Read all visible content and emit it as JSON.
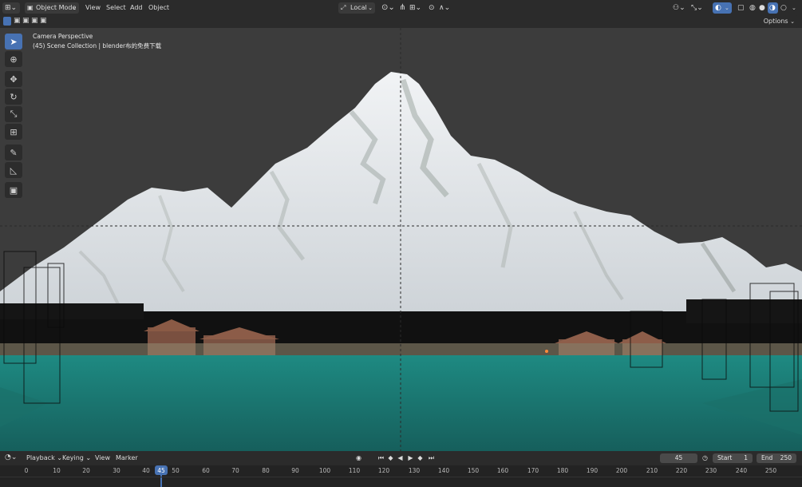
{
  "header": {
    "mode_label": "Object Mode",
    "menus": [
      "View",
      "Select",
      "Add",
      "Object"
    ],
    "orientation_label": "Local",
    "options_label": "Options"
  },
  "viewport": {
    "view_name": "Camera Perspective",
    "collection_info": "(45) Scene Collection | blender布的免费下载"
  },
  "timeline": {
    "menus": [
      "Playback",
      "Keying",
      "View",
      "Marker"
    ],
    "current_frame": "45",
    "start_label": "Start",
    "start_value": "1",
    "end_label": "End",
    "end_value": "250",
    "ticks": [
      "0",
      "10",
      "20",
      "30",
      "40",
      "45",
      "50",
      "60",
      "70",
      "80",
      "90",
      "100",
      "110",
      "120",
      "130",
      "140",
      "150",
      "160",
      "170",
      "180",
      "190",
      "200",
      "210",
      "220",
      "230",
      "240",
      "250"
    ]
  },
  "colors": {
    "accent": "#4772b3",
    "frame_marker": "#4772b3",
    "water": "#1f7f78",
    "snow": "#e8ecef"
  }
}
